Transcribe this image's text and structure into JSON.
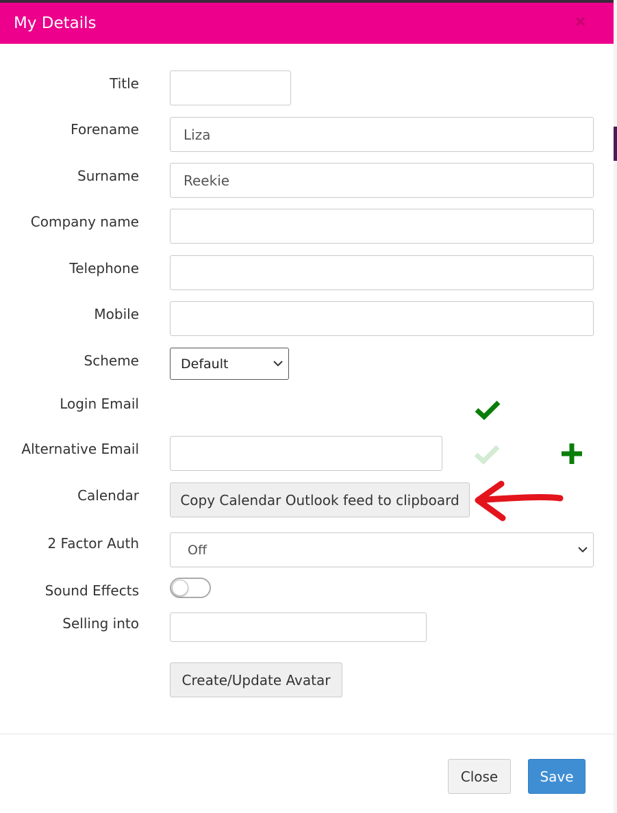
{
  "modal": {
    "title": "My Details",
    "close_symbol": "×"
  },
  "fields": {
    "title": {
      "label": "Title",
      "value": ""
    },
    "forename": {
      "label": "Forename",
      "value": "Liza"
    },
    "surname": {
      "label": "Surname",
      "value": "Reekie"
    },
    "company_name": {
      "label": "Company name",
      "value": ""
    },
    "telephone": {
      "label": "Telephone",
      "value": ""
    },
    "mobile": {
      "label": "Mobile",
      "value": ""
    },
    "scheme": {
      "label": "Scheme",
      "selected": "Default"
    },
    "login_email": {
      "label": "Login Email",
      "value": ""
    },
    "alternative_email": {
      "label": "Alternative Email",
      "value": ""
    },
    "calendar": {
      "label": "Calendar",
      "button_label": "Copy Calendar Outlook feed to clipboard"
    },
    "two_factor_auth": {
      "label": "2 Factor Auth",
      "selected": "Off"
    },
    "sound_effects": {
      "label": "Sound Effects",
      "enabled": false
    },
    "selling_into": {
      "label": "Selling into",
      "value": ""
    }
  },
  "avatar_button_label": "Create/Update Avatar",
  "footer": {
    "close_label": "Close",
    "save_label": "Save"
  },
  "icons": {
    "verified": "check-icon",
    "unverified": "check-faded-icon",
    "add": "plus-icon",
    "annotation": "red-arrow-icon"
  },
  "colors": {
    "header": "#ec008c",
    "primary_button": "#3f8ed4",
    "check_green": "#0a7d0a",
    "annotation_red": "#e3141c"
  }
}
